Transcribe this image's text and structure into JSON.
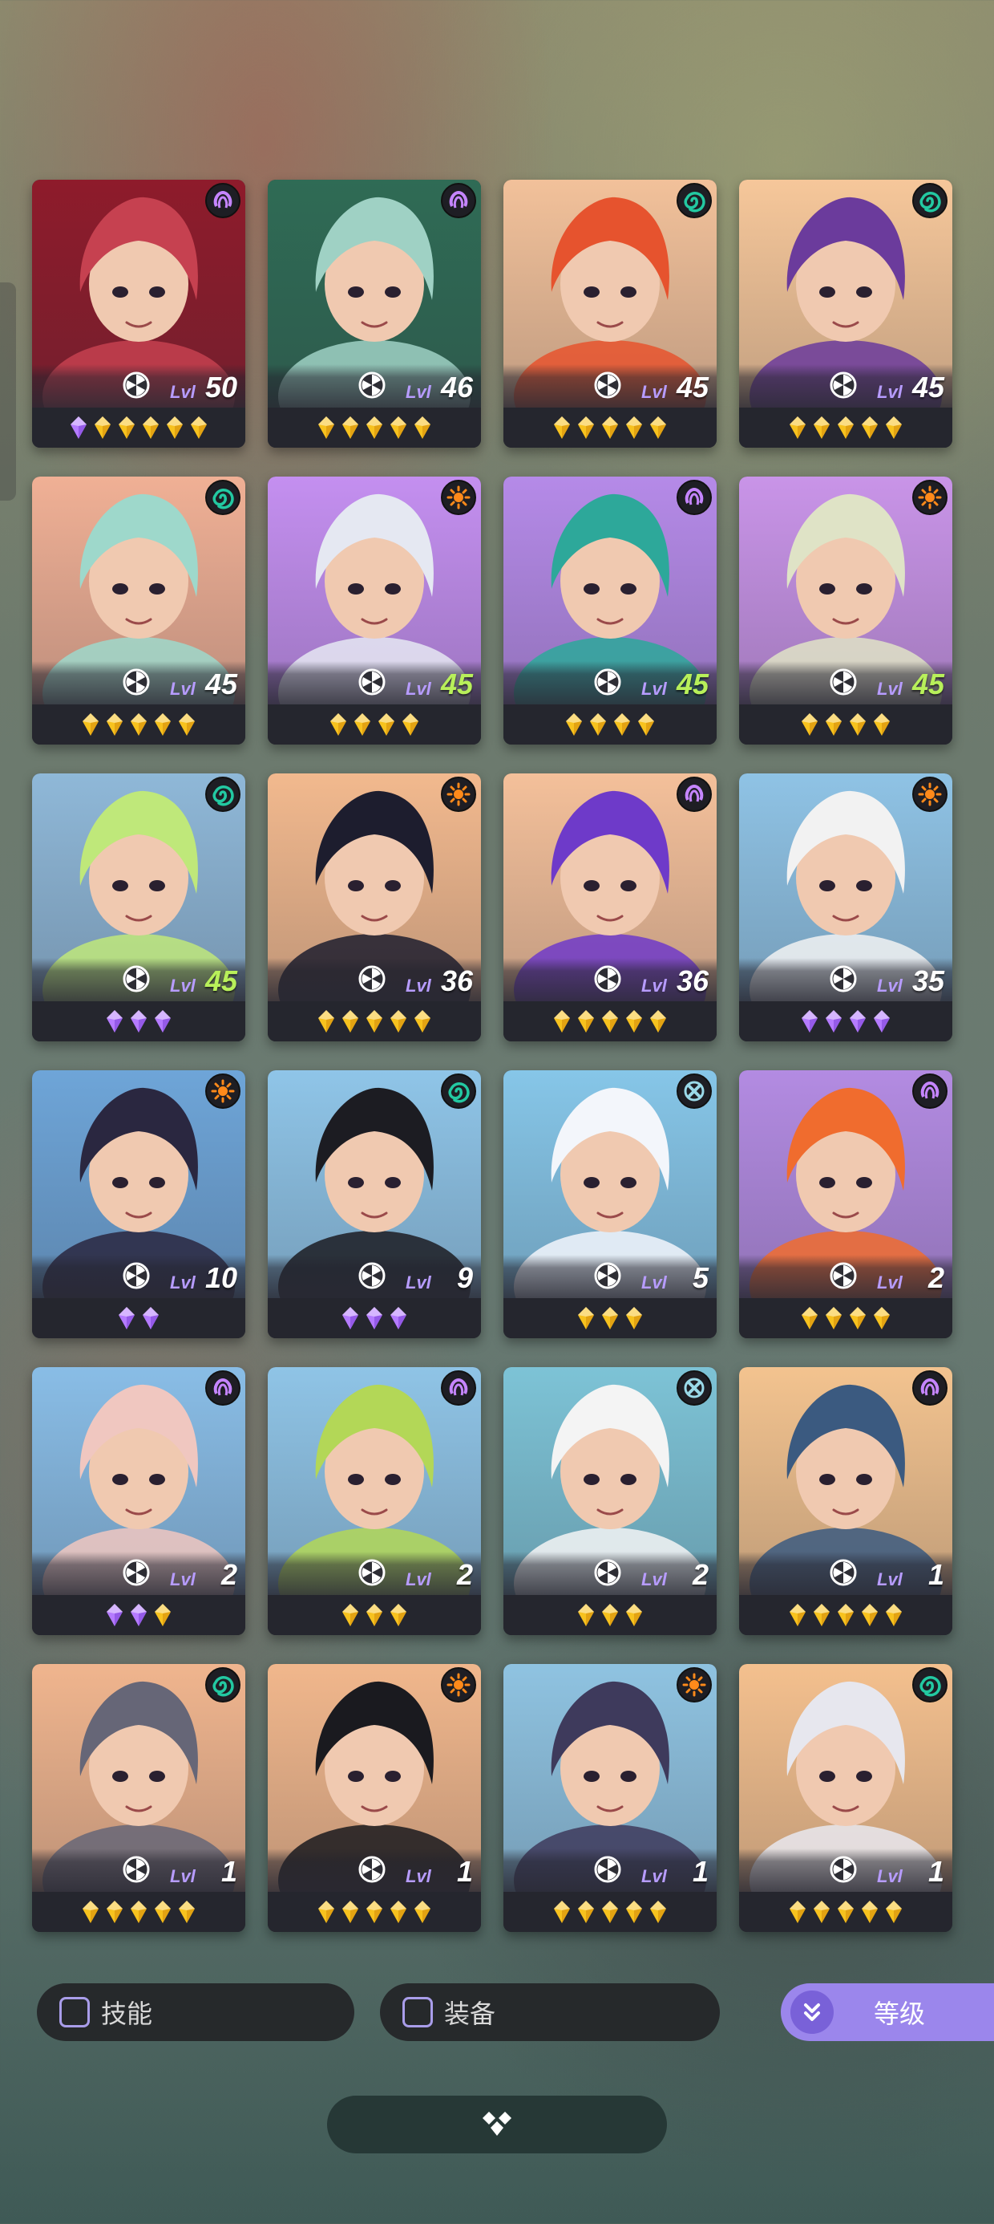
{
  "colors": {
    "level_white": "#ffffff",
    "level_yellow": "#b8f05a",
    "gem_purple": "#b57bff",
    "gem_gold": "#f7c21e",
    "faction_psy": "#c585ff",
    "faction_wind": "#23c9a2",
    "faction_sun": "#ff8a1a",
    "faction_void": "#9ad9e8",
    "sort_button": "#9b86ec"
  },
  "cards": [
    {
      "level_prefix": "Lvl",
      "level": "50",
      "faction": "psy-icon",
      "gems": [
        "purple",
        "gold",
        "gold",
        "gold",
        "gold",
        "gold"
      ],
      "colors": [
        "#8e1b2b",
        "#c64150"
      ],
      "level_color": "white"
    },
    {
      "level_prefix": "Lvl",
      "level": "46",
      "faction": "psy-icon",
      "gems": [
        "gold",
        "gold",
        "gold",
        "gold",
        "gold"
      ],
      "colors": [
        "#2f6b55",
        "#9fd1c4"
      ],
      "level_color": "white"
    },
    {
      "level_prefix": "Lvl",
      "level": "45",
      "faction": "wind-icon",
      "gems": [
        "gold",
        "gold",
        "gold",
        "gold",
        "gold"
      ],
      "colors": [
        "#f2c19a",
        "#e6532e"
      ],
      "level_color": "white"
    },
    {
      "level_prefix": "Lvl",
      "level": "45",
      "faction": "wind-icon",
      "gems": [
        "gold",
        "gold",
        "gold",
        "gold",
        "gold"
      ],
      "colors": [
        "#f6c79a",
        "#6b3b9c"
      ],
      "level_color": "white"
    },
    {
      "level_prefix": "Lvl",
      "level": "45",
      "faction": "wind-icon",
      "gems": [
        "gold",
        "gold",
        "gold",
        "gold",
        "gold"
      ],
      "colors": [
        "#f0b095",
        "#9ed8cb"
      ],
      "level_color": "white"
    },
    {
      "level_prefix": "Lvl",
      "level": "45",
      "faction": "sun-icon",
      "gems": [
        "gold",
        "gold",
        "gold",
        "gold"
      ],
      "colors": [
        "#c48ff0",
        "#e5e8f2"
      ],
      "level_color": "yellow"
    },
    {
      "level_prefix": "Lvl",
      "level": "45",
      "faction": "psy-icon",
      "gems": [
        "gold",
        "gold",
        "gold",
        "gold"
      ],
      "colors": [
        "#b58ae8",
        "#2da89a"
      ],
      "level_color": "yellow"
    },
    {
      "level_prefix": "Lvl",
      "level": "45",
      "faction": "sun-icon",
      "gems": [
        "gold",
        "gold",
        "gold",
        "gold"
      ],
      "colors": [
        "#c994e8",
        "#dfe3c6"
      ],
      "level_color": "yellow"
    },
    {
      "level_prefix": "Lvl",
      "level": "45",
      "faction": "wind-icon",
      "gems": [
        "purple",
        "purple",
        "purple"
      ],
      "colors": [
        "#8fb8d8",
        "#bfe87a"
      ],
      "level_color": "yellow"
    },
    {
      "level_prefix": "Lvl",
      "level": "36",
      "faction": "sun-icon",
      "gems": [
        "gold",
        "gold",
        "gold",
        "gold",
        "gold"
      ],
      "colors": [
        "#f2b98e",
        "#1d1d2e"
      ],
      "level_color": "white"
    },
    {
      "level_prefix": "Lvl",
      "level": "36",
      "faction": "psy-icon",
      "gems": [
        "gold",
        "gold",
        "gold",
        "gold",
        "gold"
      ],
      "colors": [
        "#f4c09a",
        "#6e3ac9"
      ],
      "level_color": "white"
    },
    {
      "level_prefix": "Lvl",
      "level": "35",
      "faction": "sun-icon",
      "gems": [
        "purple",
        "purple",
        "purple",
        "purple"
      ],
      "colors": [
        "#8fc3e5",
        "#f2f2f2"
      ],
      "level_color": "white"
    },
    {
      "level_prefix": "Lvl",
      "level": "10",
      "faction": "sun-icon",
      "gems": [
        "purple",
        "purple"
      ],
      "colors": [
        "#6ea5d8",
        "#2a2740"
      ],
      "level_color": "white"
    },
    {
      "level_prefix": "Lvl",
      "level": "9",
      "faction": "wind-icon",
      "gems": [
        "purple",
        "purple",
        "purple"
      ],
      "colors": [
        "#8fc5e8",
        "#1c1c22"
      ],
      "level_color": "white"
    },
    {
      "level_prefix": "Lvl",
      "level": "5",
      "faction": "void-icon",
      "gems": [
        "gold",
        "gold",
        "gold"
      ],
      "colors": [
        "#86c6e8",
        "#f3f6fb"
      ],
      "level_color": "white"
    },
    {
      "level_prefix": "Lvl",
      "level": "2",
      "faction": "psy-icon",
      "gems": [
        "gold",
        "gold",
        "gold",
        "gold"
      ],
      "colors": [
        "#b38be2",
        "#f06c2e"
      ],
      "level_color": "white"
    },
    {
      "level_prefix": "Lvl",
      "level": "2",
      "faction": "psy-icon",
      "gems": [
        "purple",
        "purple",
        "gold"
      ],
      "colors": [
        "#89bde6",
        "#f0c7c0"
      ],
      "level_color": "white"
    },
    {
      "level_prefix": "Lvl",
      "level": "2",
      "faction": "psy-icon",
      "gems": [
        "gold",
        "gold",
        "gold"
      ],
      "colors": [
        "#8fc4e6",
        "#b3d757"
      ],
      "level_color": "white"
    },
    {
      "level_prefix": "Lvl",
      "level": "2",
      "faction": "void-icon",
      "gems": [
        "gold",
        "gold",
        "gold"
      ],
      "colors": [
        "#7dc3d6",
        "#f4f4f4"
      ],
      "level_color": "white"
    },
    {
      "level_prefix": "Lvl",
      "level": "1",
      "faction": "psy-icon",
      "gems": [
        "gold",
        "gold",
        "gold",
        "gold",
        "gold"
      ],
      "colors": [
        "#f3c38f",
        "#3b5a80"
      ],
      "level_color": "white"
    },
    {
      "level_prefix": "Lvl",
      "level": "1",
      "faction": "wind-icon",
      "gems": [
        "gold",
        "gold",
        "gold",
        "gold",
        "gold"
      ],
      "colors": [
        "#f0b58e",
        "#666677"
      ],
      "level_color": "white"
    },
    {
      "level_prefix": "Lvl",
      "level": "1",
      "faction": "sun-icon",
      "gems": [
        "gold",
        "gold",
        "gold",
        "gold",
        "gold"
      ],
      "colors": [
        "#f1b78c",
        "#1a1a1f"
      ],
      "level_color": "white"
    },
    {
      "level_prefix": "Lvl",
      "level": "1",
      "faction": "sun-icon",
      "gems": [
        "gold",
        "gold",
        "gold",
        "gold",
        "gold"
      ],
      "colors": [
        "#8fc3e1",
        "#3e3a5c"
      ],
      "level_color": "white"
    },
    {
      "level_prefix": "Lvl",
      "level": "1",
      "faction": "wind-icon",
      "gems": [
        "gold",
        "gold",
        "gold",
        "gold",
        "gold"
      ],
      "colors": [
        "#f4c08e",
        "#e7e7ee"
      ],
      "level_color": "white"
    }
  ],
  "filters": {
    "skill_label": "技能",
    "equipment_label": "装备",
    "sort_label": "等级"
  }
}
